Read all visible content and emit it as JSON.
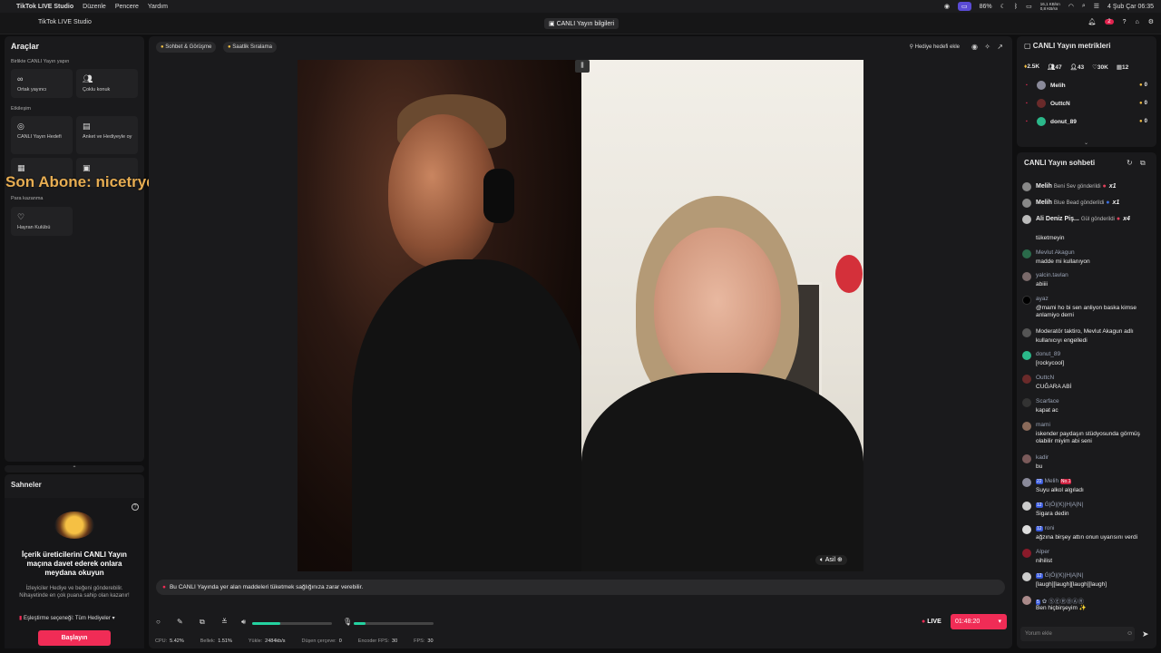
{
  "menubar": {
    "app": "TikTok LIVE Studio",
    "menus": [
      "Düzenle",
      "Pencere",
      "Yardım"
    ],
    "battery": "86%",
    "net_up": "16,1 KB/sn",
    "net_down": "0,8 KB/sn",
    "datetime": "4 Şub Çar  06:35"
  },
  "titlebar": {
    "title": "TikTok LIVE Studio",
    "center_button": "CANLI Yayın bilgileri",
    "notif_count": "2"
  },
  "tools": {
    "title": "Araçlar",
    "section1": "Birlikte CANLI Yayın yapın",
    "section2": "Etkileşim",
    "section3": "Para kazanma",
    "items": [
      {
        "label": "Ortak yayıncı",
        "icon": "link-icon"
      },
      {
        "label": "Çoklu konuk",
        "icon": "users-icon"
      },
      {
        "label": "CANLI Yayın Hedefi",
        "icon": "target-icon"
      },
      {
        "label": "Anket ve Hediyeyle oy",
        "icon": "poll-icon"
      },
      {
        "label": "Hayran Kulübü",
        "icon": "heart-icon"
      }
    ],
    "overlay": "Son Abone: nicetrydiddyverynice"
  },
  "scenes": {
    "title": "Sahneler",
    "headline": "İçerik üreticilerini CANLI Yayın maçına davet ederek onlara meydana okuyun",
    "desc": "İzleyiciler Hediye ve beğeni gönderebilir. Nihayetinde en çok puana sahip olan kazanır!",
    "choice": "Eşleştirme seçeneği: Tüm Hediyeler",
    "start": "Başlayın"
  },
  "center": {
    "chip1": "Sohbet & Görüşme",
    "chip2": "Saatlik Sıralama",
    "gift_goal": "Hediye hedefi ekle",
    "asil": "Asil",
    "warning": "Bu CANLI Yayında yer alan maddeleri tüketmek sağlığınıza zarar verebilir.",
    "live": "LIVE",
    "timer": "01:48:20",
    "volume_level": 0.35,
    "mic_level": 0.15,
    "stats": [
      {
        "label": "CPU:",
        "value": "5.42%"
      },
      {
        "label": "Bellek:",
        "value": "1.51%"
      },
      {
        "label": "Yükle:",
        "value": "2484kb/s"
      },
      {
        "label": "Düşen çerçeve:",
        "value": "0"
      },
      {
        "label": "Encoder FPS:",
        "value": "30"
      },
      {
        "label": "FPS:",
        "value": "30"
      }
    ]
  },
  "metrics": {
    "title": "CANLI Yayın metrikleri",
    "values": [
      "2.5K",
      "47",
      "43",
      "30K",
      "12"
    ],
    "viewers": [
      {
        "name": "Melih",
        "count": "0",
        "color": "#8a8a9a"
      },
      {
        "name": "OuttcN",
        "count": "0",
        "color": "#6a2a2a"
      },
      {
        "name": "donut_89",
        "count": "0",
        "color": "#2bb88a"
      }
    ]
  },
  "chat": {
    "title": "CANLI Yayın sohbeti",
    "gifts": [
      {
        "name": "Melih",
        "text": "Beni Sev gönderildi",
        "mult": "x1"
      },
      {
        "name": "Melih",
        "text": "Blue Bead gönderildi",
        "mult": "x1"
      },
      {
        "name": "Ali Deniz Piş...",
        "text": "Gül gönderildi",
        "mult": "x4"
      }
    ],
    "partial": "tüketmeyin",
    "messages": [
      {
        "user": "Mevlut Akagun",
        "text": "madde mi kullanıyon"
      },
      {
        "user": "yalcin.tavlan",
        "text": "abiiii"
      },
      {
        "user": "ayaz",
        "text": "@mami ho bi sen anliyon baska kimse anlamiyo demi"
      },
      {
        "user": "Moderatör taktiro, Mevlut Akagun adlı",
        "text": "kullanıcıyı engelledi"
      },
      {
        "user": "donut_89",
        "text": "[rockycool]"
      },
      {
        "user": "OuttcN",
        "text": "CUĞARA ABİ"
      },
      {
        "user": "Scarface",
        "text": "kapat ac"
      },
      {
        "user": "mami",
        "text": "iskender paydaşın stüdyosunda görmüş olabilir miyim abi seni"
      },
      {
        "user": "kadir",
        "text": "bu"
      },
      {
        "user": "Melih",
        "text": "Suyu alkol algıladı",
        "tag": "22",
        "tag2": "No.1"
      },
      {
        "user": "Ġ|Ö|(K)|H|A|N|",
        "text": "Sigara dedin",
        "tag": "12"
      },
      {
        "user": "roni",
        "text": "ağzına birşey attın onun uyarısını verdi",
        "tag": "12"
      },
      {
        "user": "Alper",
        "text": "nihilist"
      },
      {
        "user": "Ġ|Ö|(K)|H|A|N|",
        "text": "[laugh][laugh][laugh][laugh]",
        "tag": "12"
      },
      {
        "user": "✿ ⓈⒺⓇⒹⒶⓇ",
        "text": "Ben hiçbirşeyim ✨",
        "tag": "5"
      }
    ],
    "input_placeholder": "Yorum ekle"
  }
}
